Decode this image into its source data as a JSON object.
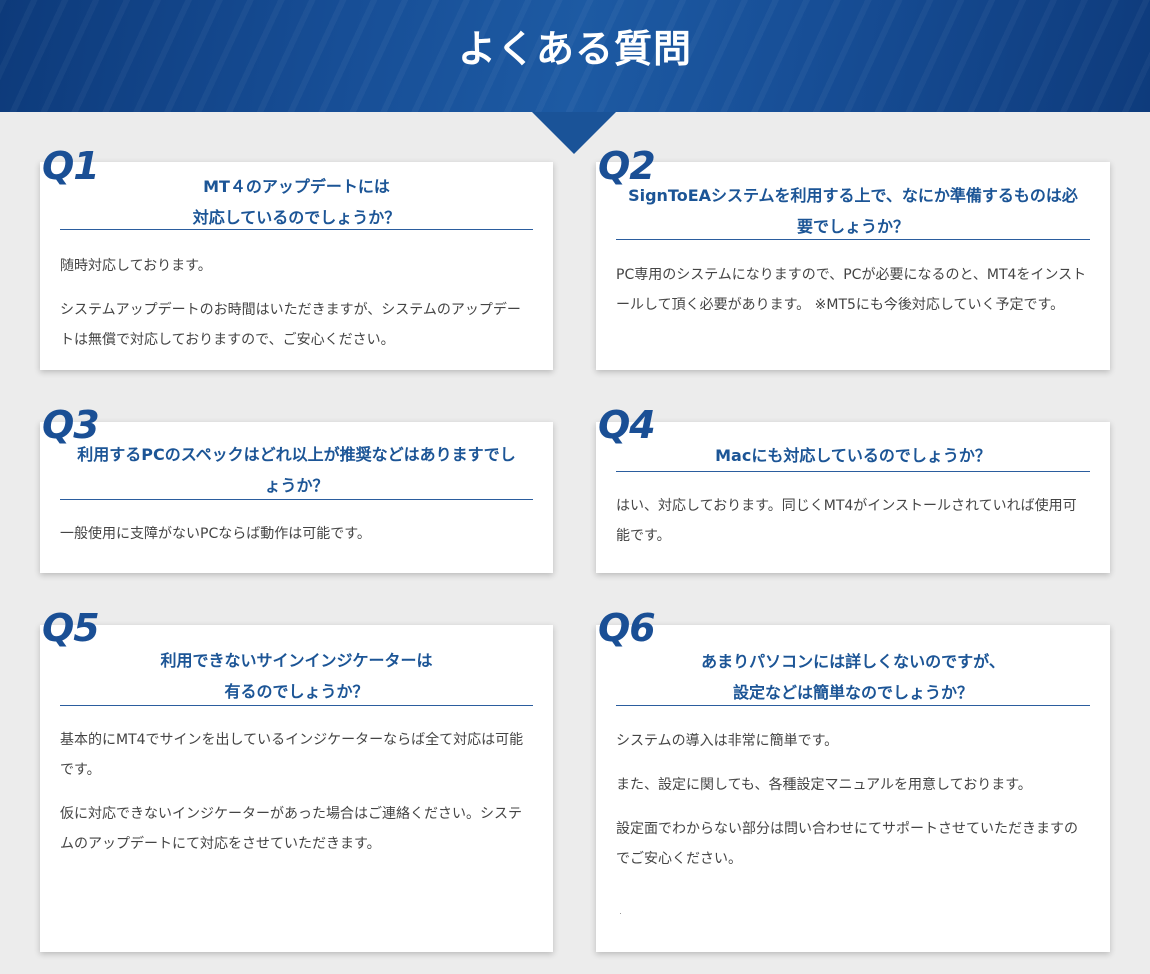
{
  "page": {
    "title": "よくある質問"
  },
  "faq": [
    {
      "number": "Q1",
      "question_lines": [
        "MT４のアップデートには",
        "対応しているのでしょうか？"
      ],
      "answer": [
        "随時対応しております。",
        "システムアップデートのお時間はいただきますが、システムのアップデートは無償で対応しておりますので、ご安心ください。"
      ]
    },
    {
      "number": "Q2",
      "question_lines": [
        "SignToEAシステムを利用する上で、なにか準備するものは必",
        "要でしょうか？"
      ],
      "answer": [
        "PC専用のシステムになりますので、PCが必要になるのと、MT4をインストールして頂く必要があります。 ※MT5にも今後対応していく予定です。"
      ]
    },
    {
      "number": "Q3",
      "question_lines": [
        "利用するPCのスペックはどれ以上が推奨などはありますでし",
        "ょうか？"
      ],
      "answer": [
        "一般使用に支障がないPCならば動作は可能です。"
      ]
    },
    {
      "number": "Q4",
      "question_lines": [
        "Macにも対応しているのでしょうか？"
      ],
      "answer": [
        "はい、対応しております。同じくMT4がインストールされていれば使用可能です。"
      ]
    },
    {
      "number": "Q5",
      "question_lines": [
        "利用できないサインインジケーターは",
        "有るのでしょうか？"
      ],
      "answer": [
        "基本的にMT4でサインを出しているインジケーターならば全て対応は可能です。",
        "仮に対応できないインジケーターがあった場合はご連絡ください。システムのアップデートにて対応をさせていただきます。"
      ]
    },
    {
      "number": "Q6",
      "question_lines": [
        "あまりパソコンには詳しくないのですが、",
        "設定などは簡単なのでしょうか？"
      ],
      "answer": [
        "システムの導入は非常に簡単です。",
        "また、設定に関しても、各種設定マニュアルを用意しております。",
        "設定面でわからない部分は問い合わせにてサポートさせていただきますのでご安心ください。"
      ]
    }
  ]
}
